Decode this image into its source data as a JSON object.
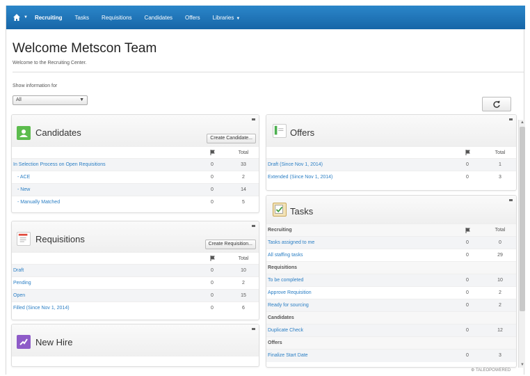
{
  "nav": {
    "items": [
      {
        "label": "Recruiting",
        "active": true
      },
      {
        "label": "Tasks",
        "active": false
      },
      {
        "label": "Requisitions",
        "active": false
      },
      {
        "label": "Candidates",
        "active": false
      },
      {
        "label": "Offers",
        "active": false
      },
      {
        "label": "Libraries",
        "active": false
      }
    ]
  },
  "page": {
    "title": "Welcome Metscon Team",
    "subtitle": "Welcome to the Recruiting Center.",
    "show_label": "Show information for",
    "show_value": "All"
  },
  "colors": {
    "nav_bg": "#1b6fb3",
    "link": "#2a7ec4"
  },
  "candidates": {
    "title": "Candidates",
    "button": "Create Candidate...",
    "total_header": "Total",
    "rows": [
      {
        "label": "In Selection Process on Open Requisitions",
        "flag": "0",
        "total": "33"
      },
      {
        "label": "- ACE",
        "flag": "0",
        "total": "2"
      },
      {
        "label": "- New",
        "flag": "0",
        "total": "14"
      },
      {
        "label": "- Manually Matched",
        "flag": "0",
        "total": "5"
      }
    ]
  },
  "requisitions": {
    "title": "Requisitions",
    "button": "Create Requisition...",
    "total_header": "Total",
    "rows": [
      {
        "label": "Draft",
        "flag": "0",
        "total": "10"
      },
      {
        "label": "Pending",
        "flag": "0",
        "total": "2"
      },
      {
        "label": "Open",
        "flag": "0",
        "total": "15"
      },
      {
        "label": "Filled (Since Nov 1, 2014)",
        "flag": "0",
        "total": "6"
      }
    ]
  },
  "newhire": {
    "title": "New Hire"
  },
  "offers": {
    "title": "Offers",
    "total_header": "Total",
    "rows": [
      {
        "label": "Draft (Since Nov 1, 2014)",
        "flag": "0",
        "total": "1"
      },
      {
        "label": "Extended (Since Nov 1, 2014)",
        "flag": "0",
        "total": "3"
      }
    ]
  },
  "tasks": {
    "title": "Tasks",
    "total_header": "Total",
    "sections": [
      {
        "name": "Recruiting",
        "rows": [
          {
            "label": "Tasks assigned to me",
            "flag": "0",
            "total": "0"
          },
          {
            "label": "All staffing tasks",
            "flag": "0",
            "total": "29"
          }
        ]
      },
      {
        "name": "Requisitions",
        "rows": [
          {
            "label": "To be completed",
            "flag": "0",
            "total": "10"
          },
          {
            "label": "Approve Requisition",
            "flag": "0",
            "total": "2"
          },
          {
            "label": "Ready for sourcing",
            "flag": "0",
            "total": "2"
          }
        ]
      },
      {
        "name": "Candidates",
        "rows": [
          {
            "label": "Duplicate Check",
            "flag": "0",
            "total": "12"
          }
        ]
      },
      {
        "name": "Offers",
        "rows": [
          {
            "label": "Finalize Start Date",
            "flag": "0",
            "total": "3"
          }
        ]
      }
    ]
  },
  "footer": {
    "brand": "TALEOPOWERED"
  }
}
